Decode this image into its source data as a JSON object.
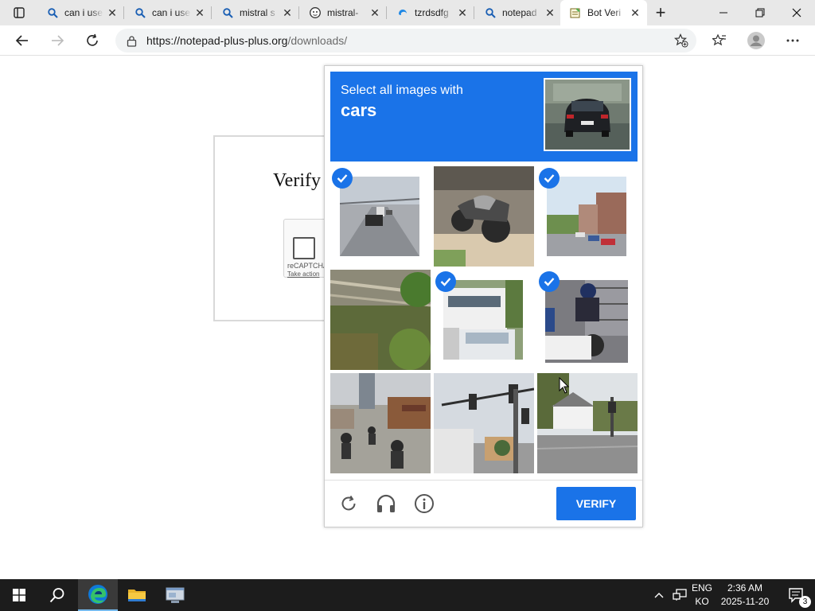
{
  "browser": {
    "tabs": [
      {
        "title": "can i use",
        "favicon": "search-icon"
      },
      {
        "title": "can i use",
        "favicon": "search-icon"
      },
      {
        "title": "mistral s",
        "favicon": "search-icon"
      },
      {
        "title": "mistral-",
        "favicon": "github-icon"
      },
      {
        "title": "tzrdsdfg",
        "favicon": "edge-swirl-icon"
      },
      {
        "title": "notepad",
        "favicon": "search-icon"
      },
      {
        "title": "Bot Veri",
        "favicon": "notepad-icon",
        "active": true
      }
    ],
    "url_host": "https://notepad-plus-plus.org",
    "url_path": "/downloads/"
  },
  "page": {
    "heading": "Verify",
    "recaptcha_brand": "reCAPTCHA",
    "recaptcha_action": "Take action"
  },
  "captcha": {
    "lead": "Select all images with",
    "target": "cars",
    "verify_label": "VERIFY",
    "tiles": [
      {
        "content": "highway with cars",
        "selected": true
      },
      {
        "content": "motorcycle close-up",
        "selected": false
      },
      {
        "content": "street with parked cars",
        "selected": true
      },
      {
        "content": "bridge railing with trees",
        "selected": false
      },
      {
        "content": "bus and car",
        "selected": true
      },
      {
        "content": "scooter with car",
        "selected": true
      },
      {
        "content": "motorcyclists on street",
        "selected": false
      },
      {
        "content": "traffic lights at intersection",
        "selected": false
      },
      {
        "content": "house at corner",
        "selected": false
      }
    ],
    "accent_color": "#1a73e8"
  },
  "taskbar": {
    "lang_top": "ENG",
    "lang_bottom": "KO",
    "time": "2:36 AM",
    "date": "2025-11-20",
    "notification_count": "3"
  }
}
